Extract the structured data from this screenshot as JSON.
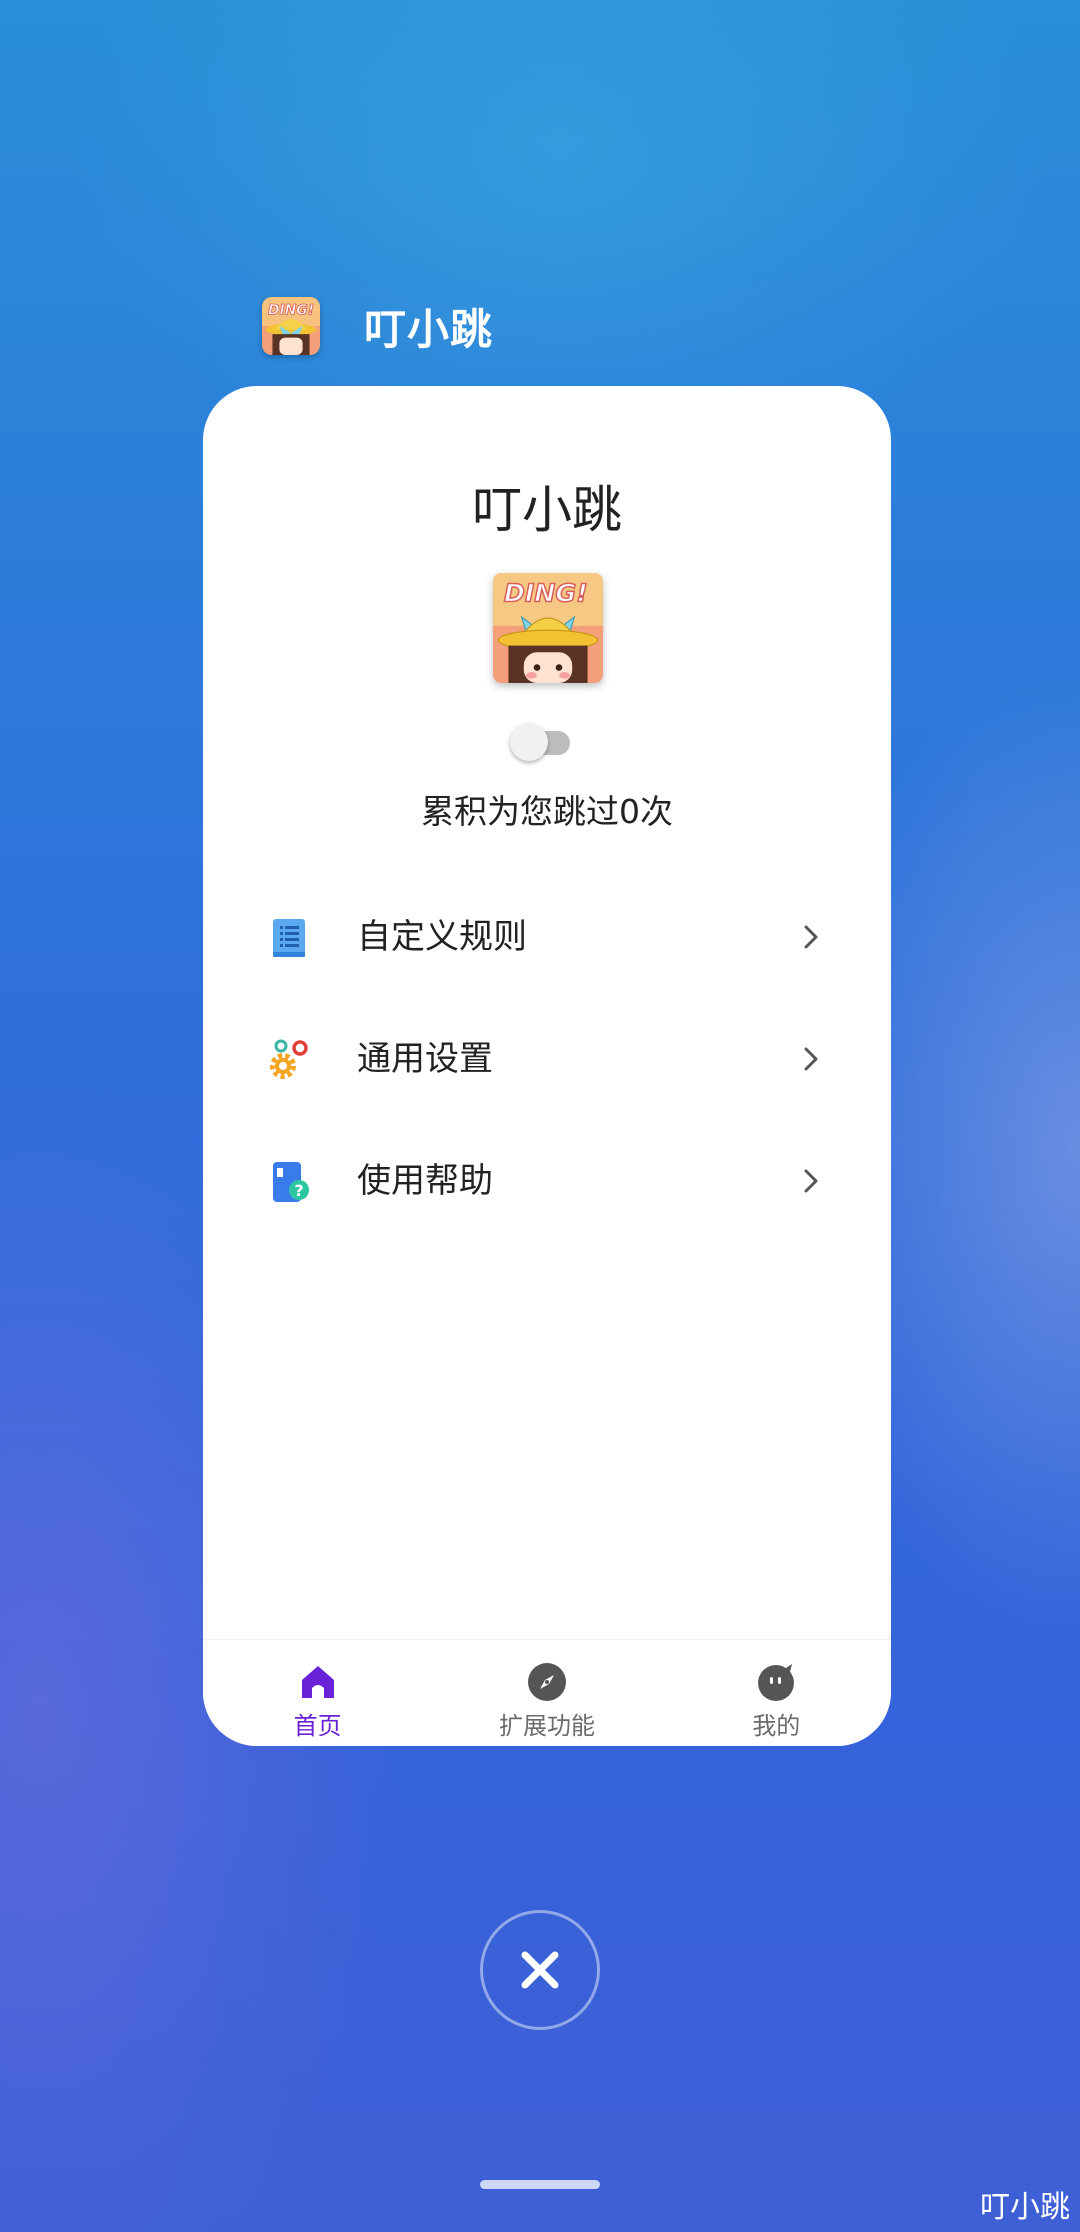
{
  "recents": {
    "app_name": "叮小跳",
    "icon": "ding-girl-app-icon",
    "close_icon": "close-icon"
  },
  "app": {
    "title": "叮小跳",
    "logo_text": "DING!",
    "toggle_on": false,
    "counter_text": "累积为您跳过0次",
    "menu": [
      {
        "label": "自定义规则",
        "icon": "document-list-icon"
      },
      {
        "label": "通用设置",
        "icon": "gears-icon"
      },
      {
        "label": "使用帮助",
        "icon": "help-book-icon"
      }
    ],
    "nav": [
      {
        "label": "首页",
        "icon": "home-icon",
        "active": true
      },
      {
        "label": "扩展功能",
        "icon": "compass-icon",
        "active": false
      },
      {
        "label": "我的",
        "icon": "profile-face-icon",
        "active": false
      }
    ],
    "accent_color": "#6a22d8"
  },
  "watermark": "叮小跳"
}
